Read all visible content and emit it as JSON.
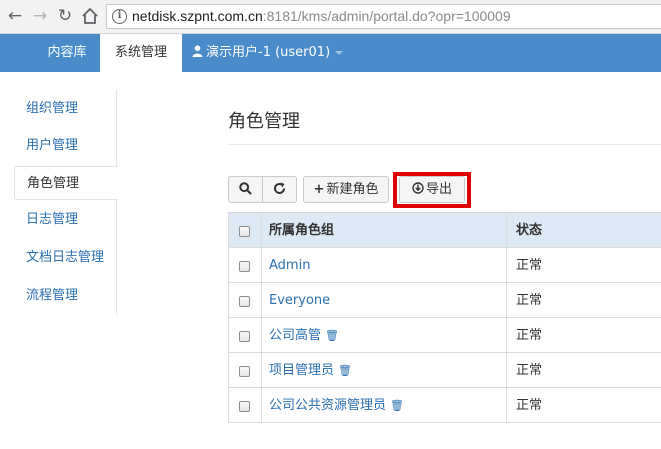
{
  "browser": {
    "url_host": "netdisk.szpnt.com.cn",
    "url_rest": ":8181/kms/admin/portal.do?opr=100009"
  },
  "topnav": {
    "tabs": [
      {
        "label": "内容库",
        "active": false
      },
      {
        "label": "系统管理",
        "active": true
      },
      {
        "label": "演示用户-1 (user01)",
        "active": false
      }
    ]
  },
  "sidebar": {
    "items": [
      {
        "label": "组织管理",
        "active": false
      },
      {
        "label": "用户管理",
        "active": false
      },
      {
        "label": "角色管理",
        "active": true
      },
      {
        "label": "日志管理",
        "active": false
      },
      {
        "label": "文档日志管理",
        "active": false
      },
      {
        "label": "流程管理",
        "active": false
      }
    ]
  },
  "main": {
    "title": "角色管理",
    "toolbar": {
      "new_role_label": "新建角色",
      "export_label": "导出"
    },
    "table": {
      "headers": [
        "所属角色组",
        "状态"
      ],
      "rows": [
        {
          "name": "Admin",
          "status": "正常",
          "deletable": false
        },
        {
          "name": "Everyone",
          "status": "正常",
          "deletable": false
        },
        {
          "name": "公司高管",
          "status": "正常",
          "deletable": true
        },
        {
          "name": "项目管理员",
          "status": "正常",
          "deletable": true
        },
        {
          "name": "公司公共资源管理员",
          "status": "正常",
          "deletable": true
        }
      ]
    }
  },
  "colors": {
    "topnav_bg": "#4a8bc9",
    "link": "#2a6fb0",
    "table_head_bg": "#dde9f5",
    "highlight_border": "#e00000"
  },
  "icons": [
    "back-icon",
    "forward-icon",
    "reload-icon",
    "home-icon",
    "info-icon",
    "user-icon",
    "search-icon",
    "refresh-icon",
    "plus-icon",
    "download-icon",
    "trash-icon"
  ]
}
